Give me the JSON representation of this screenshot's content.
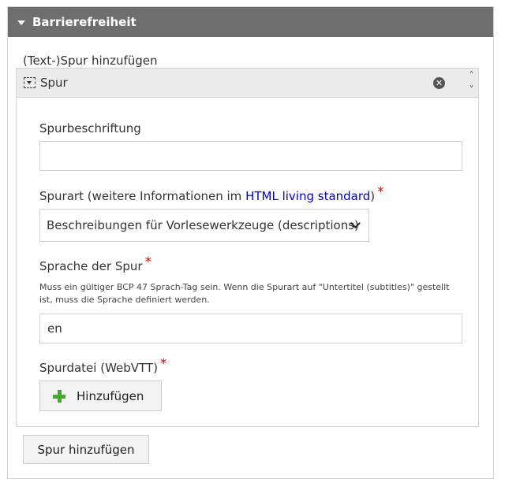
{
  "section": {
    "title": "Barrierefreiheit"
  },
  "add_track_label": "(Text-)Spur hinzufügen",
  "track": {
    "title": "Spur",
    "label_field": {
      "label": "Spurbeschriftung",
      "value": ""
    },
    "kind_field": {
      "label_prefix": "Spurart (weitere Informationen im ",
      "link_text": "HTML living standard",
      "label_suffix": ")",
      "required_mark": "*",
      "selected": "Beschreibungen für Vorlesewerkzeuge (descriptions)"
    },
    "lang_field": {
      "label": "Sprache der Spur",
      "required_mark": "*",
      "help": "Muss ein gültiger BCP 47 Sprach-Tag sein. Wenn die Spurart auf \"Untertitel (subtitles)\" gestellt ist, muss die Sprache definiert werden.",
      "value": "en"
    },
    "file_field": {
      "label": "Spurdatei (WebVTT)",
      "required_mark": "*",
      "add_button": "Hinzufügen"
    }
  },
  "add_track_button": "Spur hinzufügen",
  "icons": {
    "header": "caret-down-icon",
    "drag": "drag-handle-icon",
    "remove": "remove-icon",
    "order": "up-down-arrows-icon",
    "select": "chevron-down-icon",
    "add": "plus-icon"
  },
  "colors": {
    "header_bg": "#6e6e6e",
    "required": "#e00000",
    "link": "#0000cc",
    "plus": "#3fae29"
  }
}
